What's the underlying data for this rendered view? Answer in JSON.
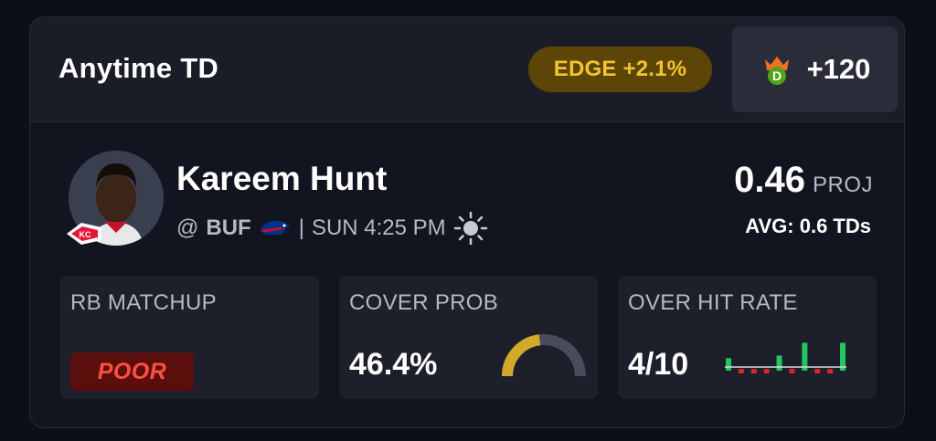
{
  "header": {
    "market_title": "Anytime TD",
    "edge_badge": "EDGE +2.1%",
    "sportsbook_icon": "draftkings-crown-icon",
    "odds": "+120"
  },
  "player": {
    "name": "Kareem Hunt",
    "team_logo_icon": "kansas-city-chiefs-logo",
    "opponent_prefix": "@",
    "opponent": "BUF",
    "opponent_logo_icon": "buffalo-bills-logo",
    "separator": "|",
    "game_time": "SUN 4:25 PM",
    "weather_icon": "sun-icon"
  },
  "projection": {
    "value": "0.46",
    "label": "PROJ",
    "average": "AVG: 0.6 TDs"
  },
  "stats": {
    "matchup": {
      "label": "RB MATCHUP",
      "rating": "POOR",
      "rating_color": "#ff4f45"
    },
    "cover": {
      "label": "COVER PROB",
      "value": "46.4%",
      "fraction": 0.464,
      "fill_color": "#d4a92a",
      "track_color": "#4a4d59"
    },
    "hit_rate": {
      "label": "OVER HIT RATE",
      "value": "4/10",
      "games": [
        {
          "hit": true,
          "level": 0.35
        },
        {
          "hit": false,
          "level": 0.1
        },
        {
          "hit": false,
          "level": 0.1
        },
        {
          "hit": false,
          "level": 0.1
        },
        {
          "hit": true,
          "level": 0.45
        },
        {
          "hit": false,
          "level": 0.1
        },
        {
          "hit": true,
          "level": 0.95
        },
        {
          "hit": false,
          "level": 0.1
        },
        {
          "hit": false,
          "level": 0.1
        },
        {
          "hit": true,
          "level": 0.95
        }
      ],
      "hit_color": "#22c55e",
      "miss_color": "#dc2626"
    }
  },
  "colors": {
    "background": "#0b0f18",
    "card": "#12151f",
    "edge_badge_bg": "#5c4506",
    "edge_badge_text": "#f2c431"
  }
}
